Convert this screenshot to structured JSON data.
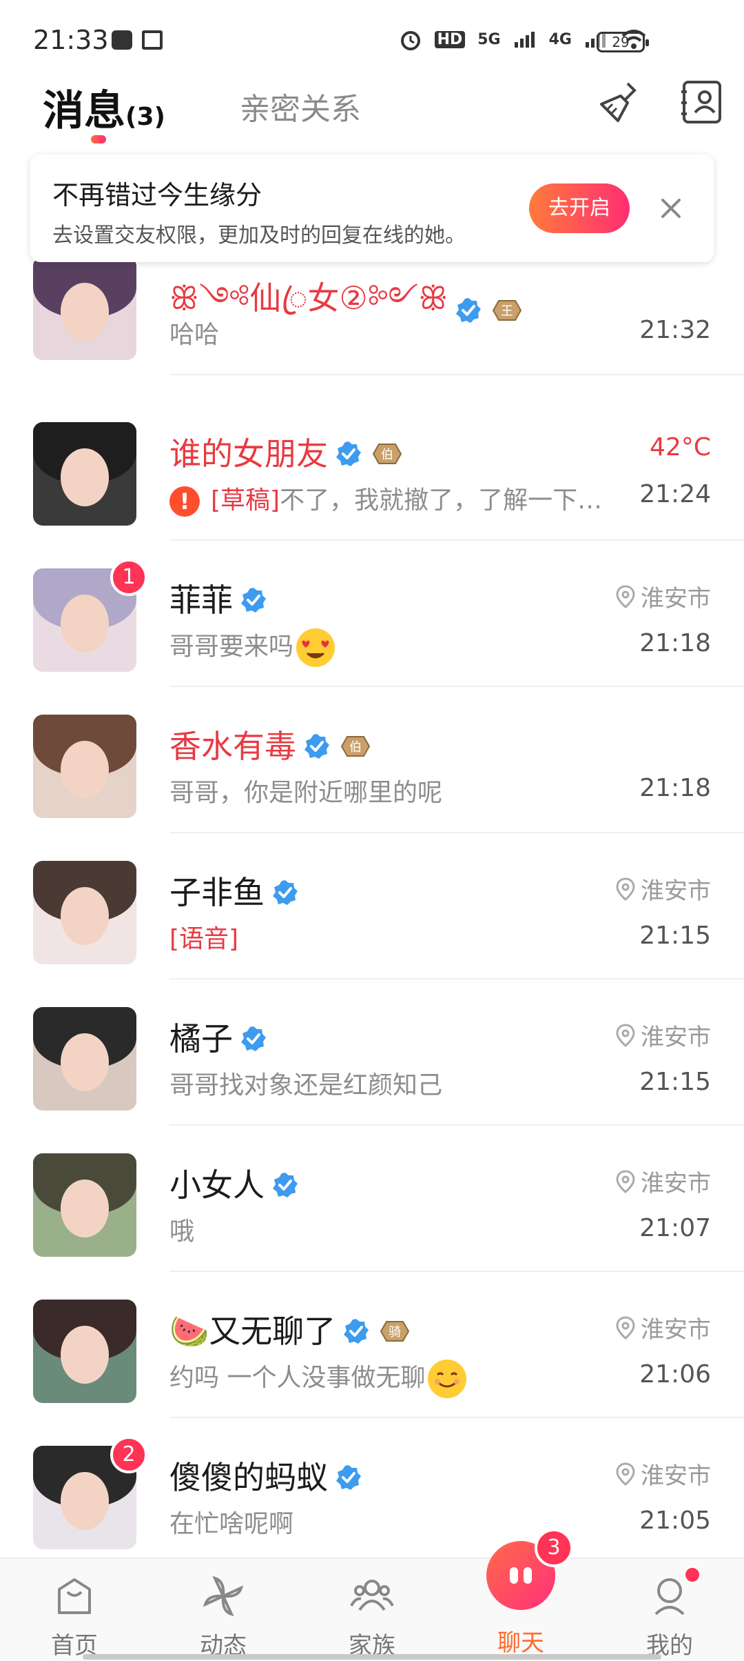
{
  "status_bar": {
    "time": "21:33",
    "network_labels": [
      "HD",
      "5G",
      "4G"
    ],
    "battery": "29"
  },
  "header": {
    "tab_messages": "消息",
    "tab_messages_count": "(3)",
    "tab_relations": "亲密关系",
    "icons": [
      "broom-icon",
      "contacts-icon"
    ]
  },
  "banner": {
    "title": "不再错过今生缘分",
    "subtitle": "去设置交友权限，更加及时的回复在线的她。",
    "button": "去开启",
    "close_icon": "close-icon"
  },
  "conversations": [
    {
      "name": "ꕥ༺仙ꦿ女②༻ꕥ",
      "name_color": "red",
      "verified": true,
      "rank": "王",
      "preview": "哈哈",
      "time": "21:32",
      "location": "",
      "badge": ""
    },
    {
      "name": "谁的女朋友",
      "name_color": "red",
      "verified": true,
      "rank": "伯",
      "preview_tag": "[草稿]",
      "preview": "不了，我就撤了，了解一下…",
      "warning": true,
      "temperature": "42°C",
      "time": "21:24",
      "location": "",
      "badge": ""
    },
    {
      "name": "菲菲",
      "name_color": "black",
      "verified": true,
      "rank": "",
      "preview": "哥哥要来吗",
      "emoji": "heart-eyes-emoji",
      "time": "21:18",
      "location": "淮安市",
      "badge": "1"
    },
    {
      "name": "香水有毒",
      "name_color": "red",
      "verified": true,
      "rank": "伯",
      "preview": "哥哥，你是附近哪里的呢",
      "time": "21:18",
      "location": "",
      "badge": ""
    },
    {
      "name": "子非鱼",
      "name_color": "black",
      "verified": true,
      "rank": "",
      "preview_tag": "[语音]",
      "preview": "",
      "time": "21:15",
      "location": "淮安市",
      "badge": ""
    },
    {
      "name": "橘子",
      "name_color": "black",
      "verified": true,
      "rank": "",
      "preview": "哥哥找对象还是红颜知己",
      "time": "21:15",
      "location": "淮安市",
      "badge": ""
    },
    {
      "name": "小女人",
      "name_color": "black",
      "verified": true,
      "rank": "",
      "preview": "哦",
      "time": "21:07",
      "location": "淮安市",
      "badge": ""
    },
    {
      "name": "🍉又无聊了",
      "name_color": "black",
      "verified": true,
      "rank": "骑",
      "preview": "约吗  一个人没事做无聊",
      "emoji": "smile-emoji",
      "time": "21:06",
      "location": "淮安市",
      "badge": ""
    },
    {
      "name": "傻傻的蚂蚁",
      "name_color": "black",
      "verified": true,
      "rank": "",
      "preview": "在忙啥呢啊",
      "time": "21:05",
      "location": "淮安市",
      "badge": "2"
    }
  ],
  "bottom_nav": {
    "items": [
      {
        "label": "首页",
        "icon": "home-icon"
      },
      {
        "label": "动态",
        "icon": "pinwheel-icon"
      },
      {
        "label": "家族",
        "icon": "family-icon"
      },
      {
        "label": "聊天",
        "icon": "chat-icon",
        "active": true,
        "badge": "3"
      },
      {
        "label": "我的",
        "icon": "profile-icon"
      }
    ]
  },
  "colors": {
    "accent_gradient_start": "#ff7a3c",
    "accent_gradient_end": "#ff2e73",
    "name_red": "#e83a42",
    "verify_blue": "#3d9bf0",
    "badge_red": "#ff3355"
  }
}
